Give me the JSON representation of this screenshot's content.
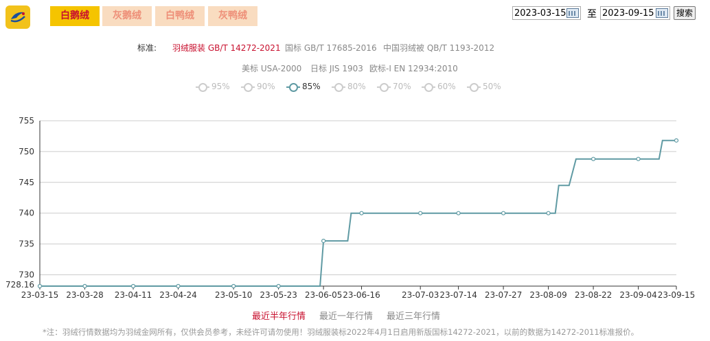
{
  "logo": {
    "icon": "brand-logo-icon"
  },
  "tabs": [
    {
      "label": "白鹅绒",
      "active": true
    },
    {
      "label": "灰鹅绒",
      "active": false
    },
    {
      "label": "白鸭绒",
      "active": false
    },
    {
      "label": "灰鸭绒",
      "active": false
    }
  ],
  "date_range": {
    "start": "2023-03-15",
    "to_label": "至",
    "end": "2023-09-15",
    "search_label": "搜索"
  },
  "standards": {
    "label": "标准:",
    "items": [
      {
        "label": "羽绒服装 GB/T 14272-2021",
        "active": true
      },
      {
        "label": "国标 GB/T 17685-2016",
        "active": false
      },
      {
        "label": "中国羽绒被 QB/T 1193-2012",
        "active": false
      },
      {
        "label": "美标 USA-2000",
        "active": false
      },
      {
        "label": "日标 JIS 1903",
        "active": false
      },
      {
        "label": "欧标-I EN 12934:2010",
        "active": false
      }
    ]
  },
  "grades": [
    {
      "label": "95%",
      "active": false
    },
    {
      "label": "90%",
      "active": false
    },
    {
      "label": "85%",
      "active": true
    },
    {
      "label": "80%",
      "active": false
    },
    {
      "label": "70%",
      "active": false
    },
    {
      "label": "60%",
      "active": false
    },
    {
      "label": "50%",
      "active": false
    }
  ],
  "ranges": [
    {
      "label": "最近半年行情",
      "active": true
    },
    {
      "label": "最近一年行情",
      "active": false
    },
    {
      "label": "最近三年行情",
      "active": false
    }
  ],
  "footnote": "*注：羽绒行情数据均为羽绒金网所有，仅供会员参考，未经许可请勿使用！羽绒服装标2022年4月1日启用新版国标14272-2021，以前的数据为14272-2011标准报价。",
  "chart_data": {
    "type": "line",
    "step": true,
    "color": "#5f9aa3",
    "grid": true,
    "ylim": [
      728.16,
      755
    ],
    "yticks": [
      755,
      750,
      745,
      740,
      735,
      730
    ],
    "ymin_label": "728.16",
    "xlim": [
      "2023-03-15",
      "2023-09-15"
    ],
    "xticks": [
      "23-03-15",
      "23-03-28",
      "23-04-11",
      "23-04-24",
      "23-05-10",
      "23-05-23",
      "23-06-05",
      "23-06-16",
      "23-07-03",
      "23-07-14",
      "23-07-27",
      "23-08-09",
      "23-08-22",
      "23-09-04",
      "23-09-15"
    ],
    "points": [
      {
        "x": "2023-03-15",
        "y": 728.16
      },
      {
        "x": "2023-03-28",
        "y": 728.16
      },
      {
        "x": "2023-04-11",
        "y": 728.16
      },
      {
        "x": "2023-04-24",
        "y": 728.16
      },
      {
        "x": "2023-05-10",
        "y": 728.16
      },
      {
        "x": "2023-05-23",
        "y": 728.16
      },
      {
        "x": "2023-06-04",
        "y": 728.16
      },
      {
        "x": "2023-06-05",
        "y": 735.5
      },
      {
        "x": "2023-06-12",
        "y": 735.5
      },
      {
        "x": "2023-06-13",
        "y": 740
      },
      {
        "x": "2023-06-16",
        "y": 740
      },
      {
        "x": "2023-07-03",
        "y": 740
      },
      {
        "x": "2023-07-14",
        "y": 740
      },
      {
        "x": "2023-07-27",
        "y": 740
      },
      {
        "x": "2023-08-09",
        "y": 740
      },
      {
        "x": "2023-08-11",
        "y": 740
      },
      {
        "x": "2023-08-12",
        "y": 744.5
      },
      {
        "x": "2023-08-15",
        "y": 744.5
      },
      {
        "x": "2023-08-17",
        "y": 748.8
      },
      {
        "x": "2023-08-22",
        "y": 748.8
      },
      {
        "x": "2023-09-04",
        "y": 748.8
      },
      {
        "x": "2023-09-10",
        "y": 748.8
      },
      {
        "x": "2023-09-11",
        "y": 751.8
      },
      {
        "x": "2023-09-15",
        "y": 751.8
      }
    ],
    "markers": [
      "2023-03-15",
      "2023-03-28",
      "2023-04-11",
      "2023-04-24",
      "2023-05-10",
      "2023-05-23",
      "2023-06-05",
      "2023-06-16",
      "2023-07-03",
      "2023-07-14",
      "2023-07-27",
      "2023-08-09",
      "2023-08-22",
      "2023-09-04",
      "2023-09-15"
    ]
  }
}
